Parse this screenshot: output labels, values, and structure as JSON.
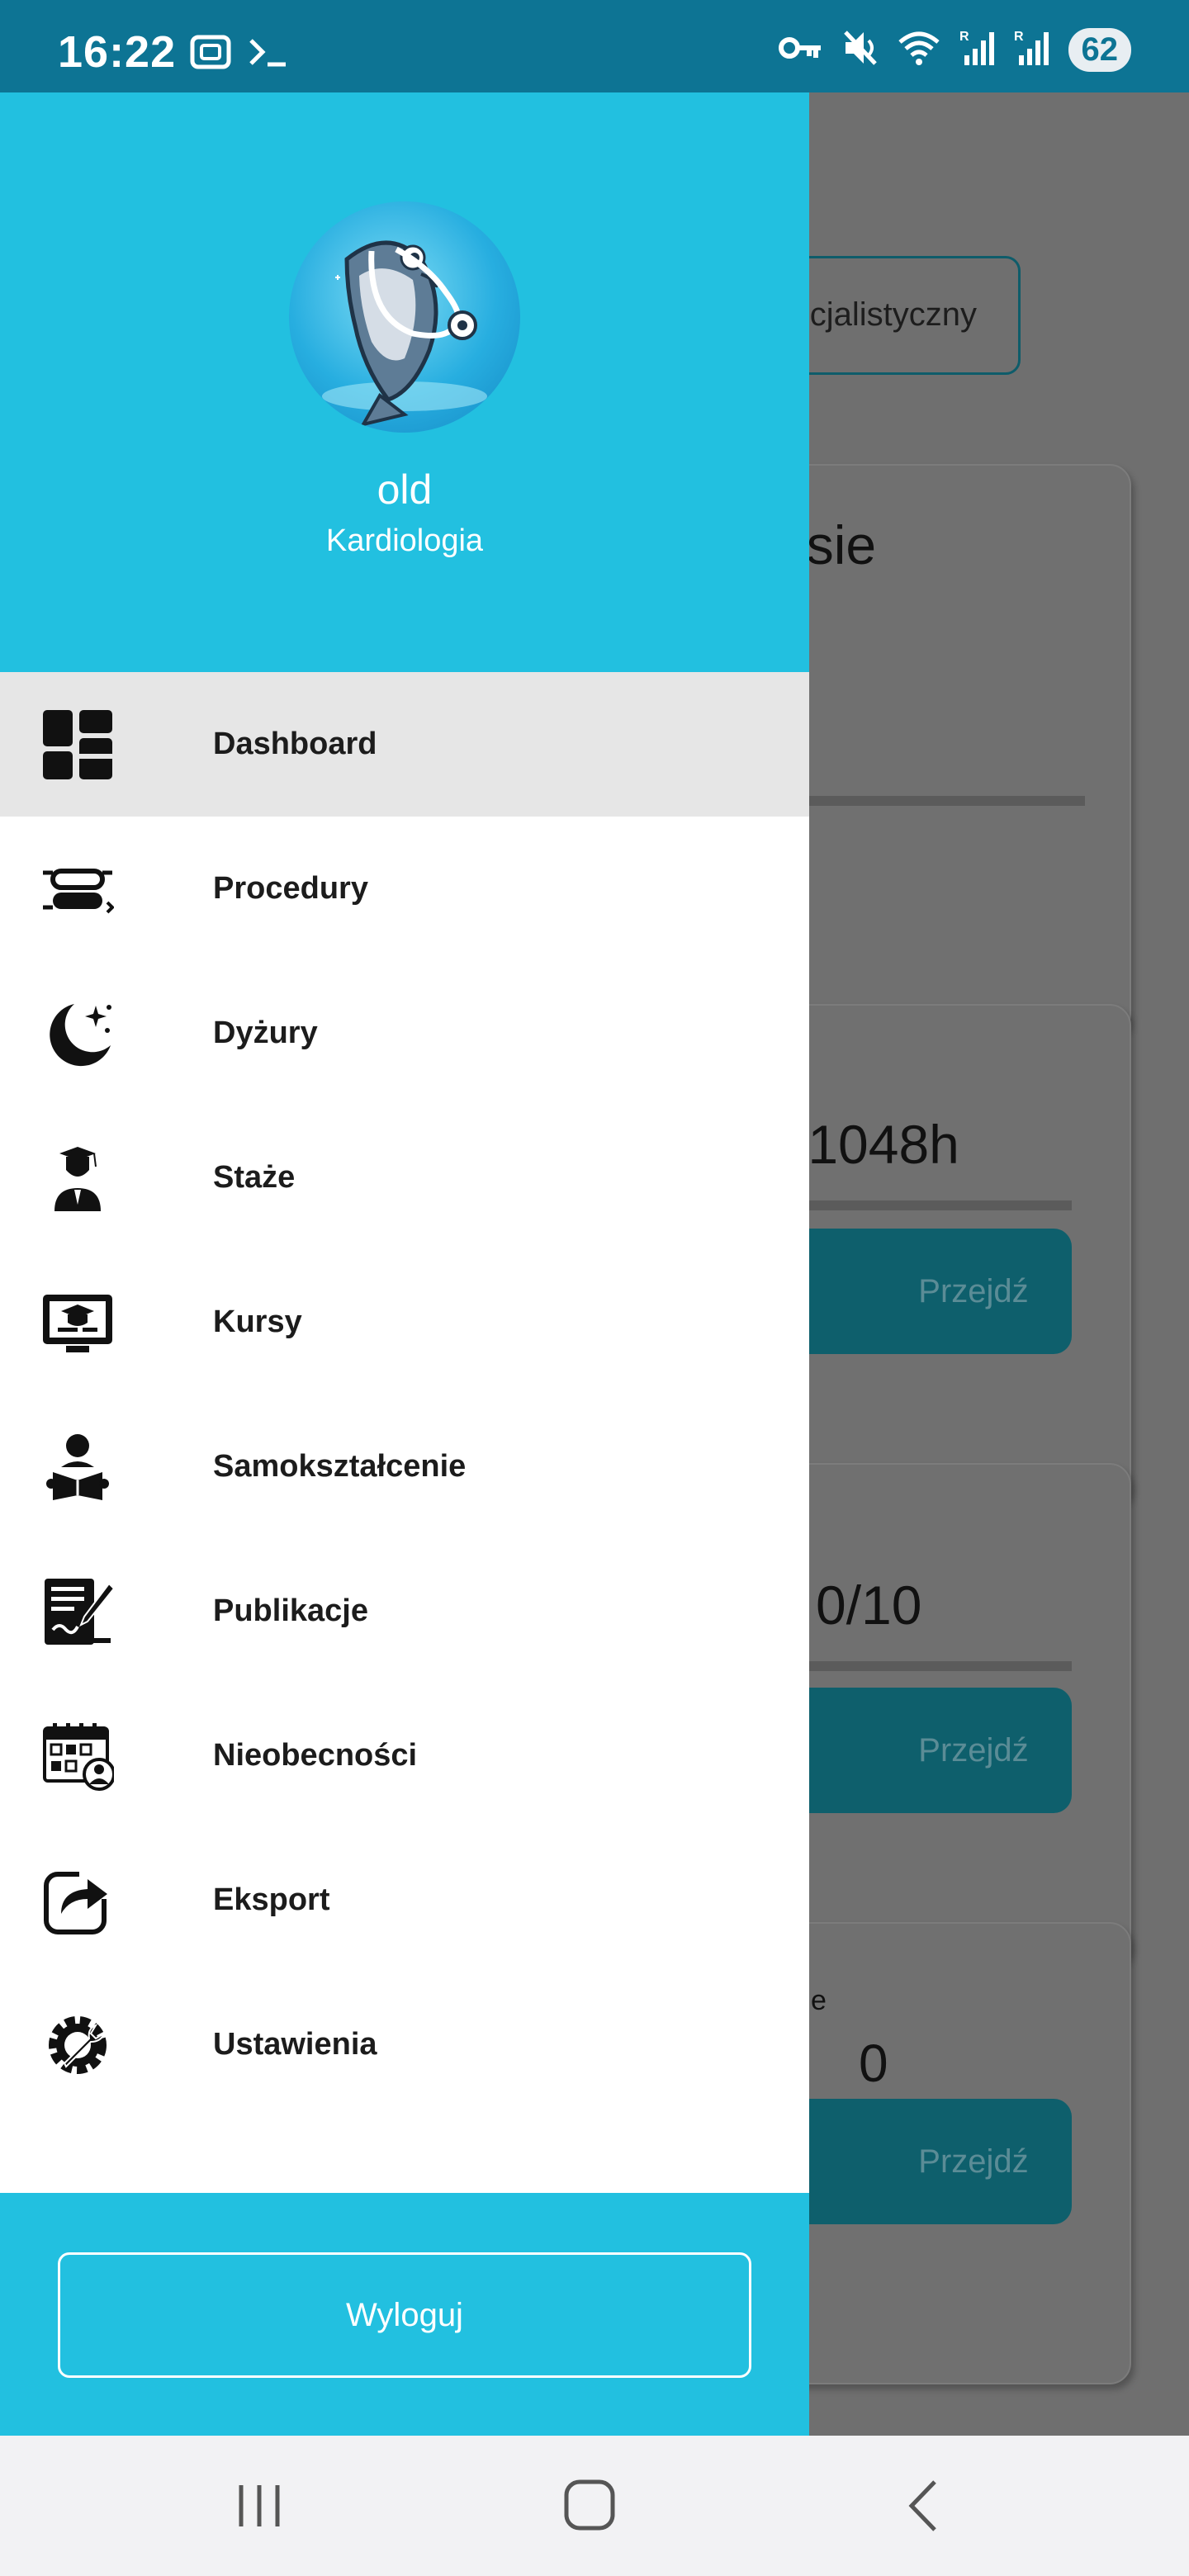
{
  "status_bar": {
    "time": "16:22",
    "left_icons": [
      "screenshot-icon",
      "terminal-icon"
    ],
    "right_icons": [
      "vpn-key-icon",
      "mute-icon",
      "wifi-icon",
      "signal-icon",
      "signal-icon"
    ],
    "battery": "62"
  },
  "background_app": {
    "select_text": "cjalistyczny",
    "card1_title": "esie",
    "card2_value": "/1048h",
    "card2_button": "Przejdź",
    "card3_value": "0/10",
    "card3_button": "Przejdź",
    "card4_label": "e",
    "card4_value": "0",
    "card4_button": "Przejdź"
  },
  "drawer": {
    "header": {
      "avatar": "fish-doctor-avatar",
      "user_name": "old",
      "specialization": "Kardiologia",
      "colors": {
        "header_bg": "#22c0e0",
        "active_item_bg": "#e6e6e6"
      }
    },
    "menu": [
      {
        "label": "Dashboard",
        "icon": "dashboard-icon",
        "active": true
      },
      {
        "label": "Procedury",
        "icon": "procedures-icon",
        "active": false
      },
      {
        "label": "Dyżury",
        "icon": "moon-stars-icon",
        "active": false
      },
      {
        "label": "Staże",
        "icon": "graduate-icon",
        "active": false
      },
      {
        "label": "Kursy",
        "icon": "online-course-icon",
        "active": false
      },
      {
        "label": "Samokształcenie",
        "icon": "reading-person-icon",
        "active": false
      },
      {
        "label": "Publikacje",
        "icon": "document-edit-icon",
        "active": false
      },
      {
        "label": "Nieobecności",
        "icon": "calendar-absence-icon",
        "active": false
      },
      {
        "label": "Eksport",
        "icon": "share-export-icon",
        "active": false
      },
      {
        "label": "Ustawienia",
        "icon": "settings-wrench-icon",
        "active": false
      }
    ],
    "logout_label": "Wyloguj"
  },
  "nav_bar": {
    "buttons": [
      "recent-apps-icon",
      "home-icon",
      "back-icon"
    ]
  }
}
